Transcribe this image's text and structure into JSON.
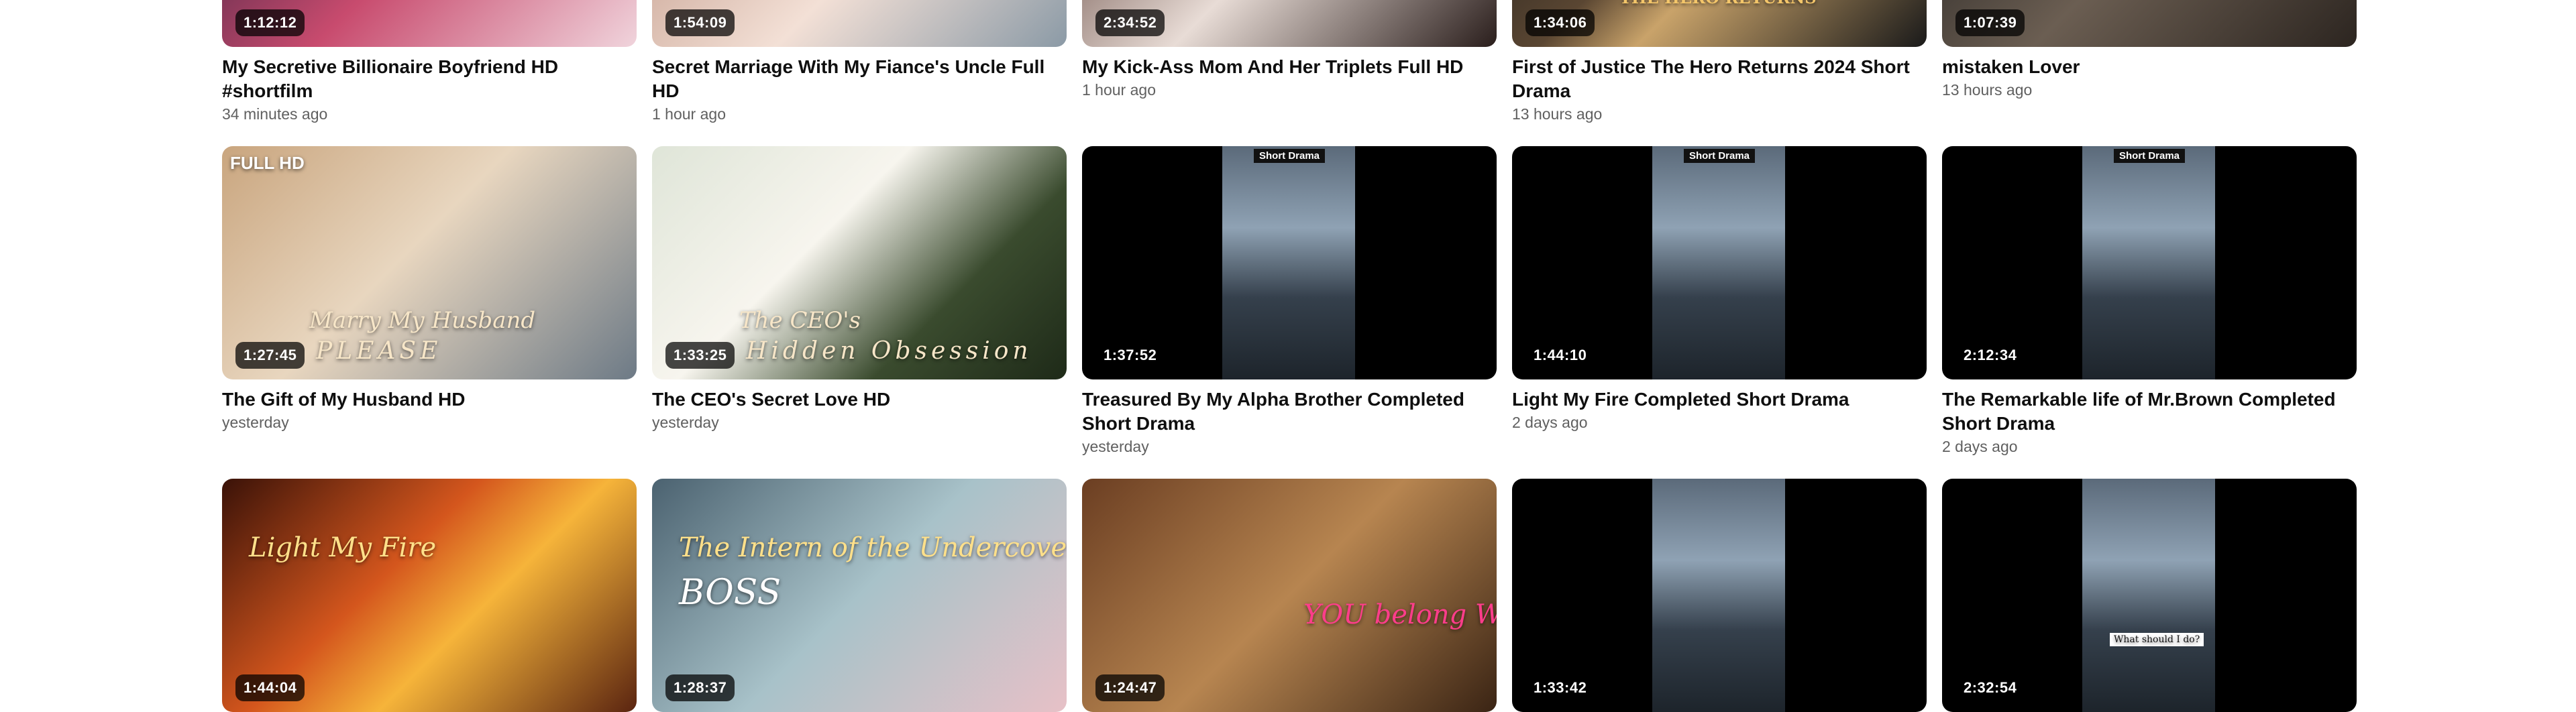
{
  "rows": [
    [
      {
        "title": "My Secretive Billionaire Boyfriend HD #shortfilm",
        "meta": "34 minutes ago",
        "duration": "1:12:12"
      },
      {
        "title": "Secret Marriage With My Fiance's Uncle Full HD",
        "meta": "1 hour ago",
        "duration": "1:54:09"
      },
      {
        "title": "My Kick-Ass Mom And Her Triplets Full HD",
        "meta": "1 hour ago",
        "duration": "2:34:52"
      },
      {
        "title": "First of Justice The Hero Returns 2024 Short Drama",
        "meta": "13 hours ago",
        "duration": "1:34:06",
        "overlay": "THE HERO RETURNS"
      },
      {
        "title": "mistaken Lover",
        "meta": "13 hours ago",
        "duration": "1:07:39"
      }
    ],
    [
      {
        "title": "The Gift of My Husband HD",
        "meta": "yesterday",
        "duration": "1:27:45",
        "badge": "FULL HD",
        "overlay": "Marry My Husband",
        "overlay2": "PLEASE"
      },
      {
        "title": "The CEO's Secret Love HD",
        "meta": "yesterday",
        "duration": "1:33:25",
        "overlay": "The CEO's",
        "overlay2": "Hidden Obsession"
      },
      {
        "title": "Treasured By My Alpha Brother Completed Short Drama",
        "meta": "yesterday",
        "duration": "1:37:52",
        "tag": "Short Drama"
      },
      {
        "title": "Light My Fire Completed Short Drama",
        "meta": "2 days ago",
        "duration": "1:44:10",
        "tag": "Short Drama"
      },
      {
        "title": "The Remarkable life of Mr.Brown Completed Short Drama",
        "meta": "2 days ago",
        "duration": "2:12:34",
        "tag": "Short Drama"
      }
    ],
    [
      {
        "duration": "1:44:04",
        "overlay": "Light My Fire"
      },
      {
        "duration": "1:28:37",
        "overlay": "The Intern of the Undercover",
        "overlay2": "BOSS"
      },
      {
        "duration": "1:24:47",
        "overlay": "YOU belong WITH ME"
      },
      {
        "duration": "1:33:42"
      },
      {
        "duration": "2:32:54",
        "overlay": "What should I do?"
      }
    ]
  ],
  "thumb_styles": [
    [
      "linear-gradient(135deg,#2b1d3c 0%,#c84b6e 50%,#f0d4dc 100%)",
      "linear-gradient(135deg,#b88c7a 0%,#f3e0d6 55%,#8b9aa6 100%)",
      "linear-gradient(135deg,#4a2a22 0%,#e8dcd6 50%,#2a1e1c 100%)",
      "linear-gradient(135deg,#1a1a1a 0%,#5a4632 40%,#c9a36a 55%,#1a1a1a 100%)",
      "linear-gradient(135deg,#1c1c1c 0%,#6b5e52 50%,#2c2520 100%)"
    ],
    [
      "linear-gradient(135deg,#c9a57e 0%,#e8d6bf 45%,#6d7a86 100%)",
      "linear-gradient(135deg,#dfe5d8 0%,#f7f5ee 40%,#3a4b2e 70%,#1e2a18 100%)",
      "",
      "",
      ""
    ],
    [
      "linear-gradient(135deg,#3a1208 0%,#d4561d 40%,#f6b43a 60%,#5a2410 100%)",
      "linear-gradient(135deg,#4b6270 0%,#a8c2c9 50%,#e7c1c7 100%)",
      "linear-gradient(135deg,#6b3e22 0%,#b78550 50%,#3a2414 100%)",
      "",
      ""
    ]
  ]
}
